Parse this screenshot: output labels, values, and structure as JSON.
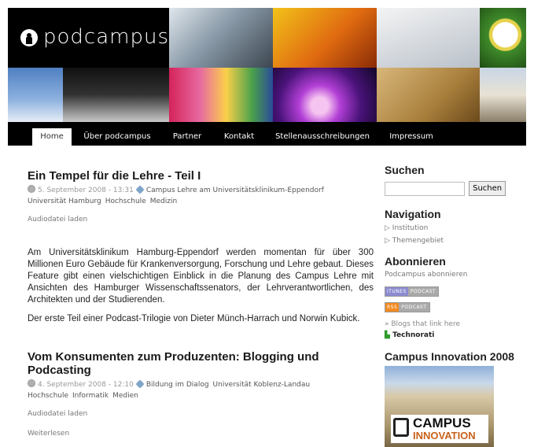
{
  "brand": {
    "name": "podcampus"
  },
  "nav": {
    "tabs": [
      {
        "label": "Home",
        "active": true
      },
      {
        "label": "Über podcampus"
      },
      {
        "label": "Partner"
      },
      {
        "label": "Kontakt"
      },
      {
        "label": "Stellenausschreibungen"
      },
      {
        "label": "Impressum"
      }
    ]
  },
  "posts": [
    {
      "title": "Ein Tempel für die Lehre - Teil I",
      "date": "5. September 2008 - 13:31",
      "tags": [
        "Campus Lehre am Universitätsklinikum-Eppendorf",
        "Universität Hamburg",
        "Hochschule",
        "Medizin"
      ],
      "audio": "Audiodatei laden",
      "paragraphs": [
        "Am Universitätsklinikum Hamburg-Eppendorf werden momentan für über 300 Millionen Euro Gebäude für Krankenversorgung, Forschung und Lehre gebaut. Dieses Feature gibt einen vielschichtigen Einblick in die Planung des Campus Lehre mit Ansichten des Hamburger Wissenschaftssenators, der Lehrverantwortlichen, des Architekten und der Studierenden.",
        "Der erste Teil einer Podcast-Trilogie von Dieter Münch-Harrach und Norwin Kubick."
      ]
    },
    {
      "title": "Vom Konsumenten zum Produzenten: Blogging und Podcasting",
      "date": "4. September 2008 - 12:10",
      "tags": [
        "Bildung im Dialog",
        "Universität Koblenz-Landau",
        "Hochschule",
        "Informatik",
        "Medien"
      ],
      "audio": "Audiodatei laden",
      "more": "Weiterlesen"
    }
  ],
  "sidebar": {
    "search": {
      "title": "Suchen",
      "button": "Suchen",
      "value": ""
    },
    "navigation": {
      "title": "Navigation",
      "items": [
        "Institution",
        "Themengebiet"
      ]
    },
    "subscribe": {
      "title": "Abonnieren",
      "label": "Podcampus abonnieren",
      "itunes": {
        "left": "iTUNES",
        "right": "PODCAST"
      },
      "rss": {
        "left": "RSS",
        "right": "PODCAST"
      },
      "blogs": "» Blogs that link here",
      "technorati": "Technorati"
    },
    "campus": {
      "title": "Campus Innovation 2008",
      "logo_top": "CAMPUS",
      "logo_bottom": "INNOVATION"
    }
  },
  "colors": {
    "header_bg": "#000000",
    "accent_blue": "#7fa6c9",
    "rss_orange": "#f28a1f"
  }
}
